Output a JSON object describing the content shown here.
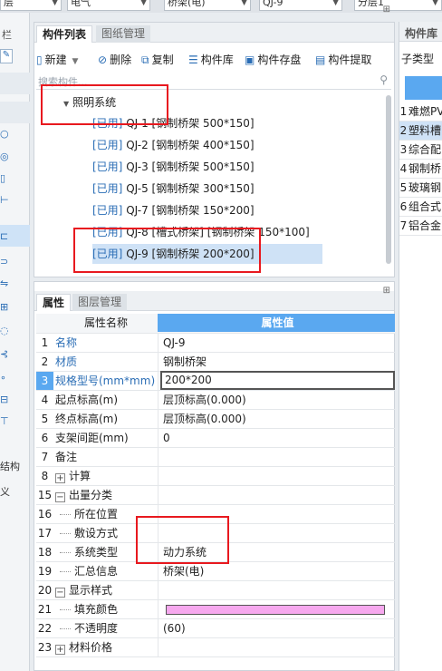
{
  "top_dropdowns": [
    {
      "value": "层"
    },
    {
      "value": "电气"
    },
    {
      "value": "桥架(电)"
    },
    {
      "value": "QJ-9"
    },
    {
      "value": "分层1"
    }
  ],
  "left_strip": {
    "header": "栏",
    "bottom_items": [
      "结构",
      "义"
    ]
  },
  "component_panel": {
    "tabs": [
      "构件列表",
      "图纸管理"
    ],
    "toolbar": {
      "new": "新建",
      "delete": "删除",
      "copy": "复制",
      "library": "构件库",
      "save": "构件存盘",
      "extract": "构件提取"
    },
    "search_placeholder": "搜索构件...",
    "tree": {
      "root": "照明系统",
      "items": [
        {
          "status": "[已用]",
          "label": "QJ-1 [钢制桥架 500*150]"
        },
        {
          "status": "[已用]",
          "label": "QJ-2 [钢制桥架 400*150]"
        },
        {
          "status": "[已用]",
          "label": "QJ-3 [钢制桥架 500*150]"
        },
        {
          "status": "[已用]",
          "label": "QJ-5 [钢制桥架 300*150]"
        },
        {
          "status": "[已用]",
          "label": "QJ-7 [钢制桥架 150*200]"
        },
        {
          "status": "[已用]",
          "label": "QJ-8 [槽式桥架]  [钢制桥架 150*100]"
        },
        {
          "status": "[已用]",
          "label": "QJ-9 [钢制桥架 200*200]"
        }
      ]
    }
  },
  "property_panel": {
    "tabs": [
      "属性",
      "图层管理"
    ],
    "headers": {
      "name": "属性名称",
      "value": "属性值"
    },
    "rows": [
      {
        "num": "1",
        "name": "名称",
        "value": "QJ-9",
        "blue": true,
        "exp": ""
      },
      {
        "num": "2",
        "name": "材质",
        "value": "钢制桥架",
        "blue": true,
        "exp": ""
      },
      {
        "num": "3",
        "name": "规格型号(mm*mm)",
        "value": "200*200",
        "blue": true,
        "exp": ""
      },
      {
        "num": "4",
        "name": "起点标高(m)",
        "value": "层顶标高(0.000)",
        "blue": false,
        "exp": ""
      },
      {
        "num": "5",
        "name": "终点标高(m)",
        "value": "层顶标高(0.000)",
        "blue": false,
        "exp": ""
      },
      {
        "num": "6",
        "name": "支架间距(mm)",
        "value": "0",
        "blue": false,
        "exp": ""
      },
      {
        "num": "7",
        "name": "备注",
        "value": "",
        "blue": false,
        "exp": ""
      },
      {
        "num": "8",
        "name": "计算",
        "value": "",
        "blue": false,
        "exp": "+"
      },
      {
        "num": "15",
        "name": "出量分类",
        "value": "",
        "blue": false,
        "exp": "-"
      },
      {
        "num": "16",
        "name": "所在位置",
        "value": "",
        "blue": false,
        "exp": "child"
      },
      {
        "num": "17",
        "name": "敷设方式",
        "value": "",
        "blue": false,
        "exp": "child"
      },
      {
        "num": "18",
        "name": "系统类型",
        "value": "动力系统",
        "blue": false,
        "exp": "child"
      },
      {
        "num": "19",
        "name": "汇总信息",
        "value": "桥架(电)",
        "blue": false,
        "exp": "child"
      },
      {
        "num": "20",
        "name": "显示样式",
        "value": "",
        "blue": false,
        "exp": "-"
      },
      {
        "num": "21",
        "name": "填充颜色",
        "value": "",
        "blue": false,
        "exp": "child"
      },
      {
        "num": "22",
        "name": "不透明度",
        "value": "(60)",
        "blue": false,
        "exp": "child"
      },
      {
        "num": "23",
        "name": "材料价格",
        "value": "",
        "blue": false,
        "exp": "+"
      }
    ],
    "fill_color": "#f6a8ee"
  },
  "right_panel": {
    "tab": "构件库",
    "subtype_label": "子类型",
    "items": [
      {
        "num": "1",
        "label": "难燃PV"
      },
      {
        "num": "2",
        "label": "塑料槽"
      },
      {
        "num": "3",
        "label": "综合配"
      },
      {
        "num": "4",
        "label": "钢制桥"
      },
      {
        "num": "5",
        "label": "玻璃钢"
      },
      {
        "num": "6",
        "label": "组合式"
      },
      {
        "num": "7",
        "label": "铝合金"
      }
    ]
  },
  "colors": {
    "accent_blue": "#2a6db5",
    "header_blue": "#5aa8f0",
    "selection": "#cfe2f6",
    "highlight_red": "#e8191f"
  }
}
